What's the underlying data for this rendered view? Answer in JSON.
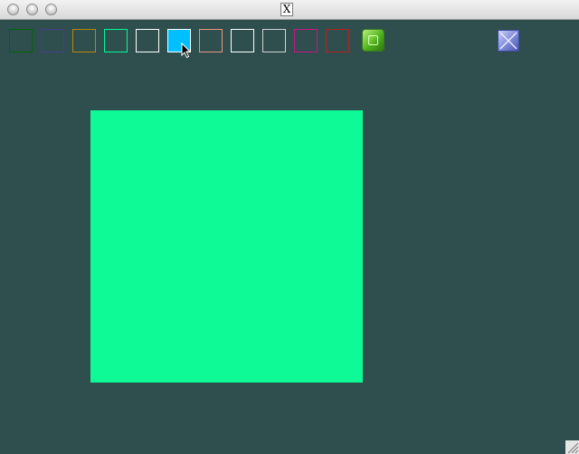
{
  "window": {
    "app_icon_letter": "X",
    "controls": [
      "close",
      "minimize",
      "zoom"
    ]
  },
  "toolbar": {
    "swatches": [
      {
        "name": "darkgreen",
        "color": "#006400",
        "selected": false
      },
      {
        "name": "darkslateblue",
        "color": "#483d8b",
        "selected": false
      },
      {
        "name": "darkgoldenrod",
        "color": "#b8860b",
        "selected": false
      },
      {
        "name": "mediumspringgreen",
        "color": "#00fa9a",
        "selected": false
      },
      {
        "name": "white",
        "color": "#ffffff",
        "selected": false
      },
      {
        "name": "deepskyblue",
        "color": "#00bfff",
        "selected": true
      },
      {
        "name": "darksalmon",
        "color": "#e9967a",
        "selected": false
      },
      {
        "name": "white-2",
        "color": "#ffffff",
        "selected": false
      },
      {
        "name": "lightgray",
        "color": "#d3d3d3",
        "selected": false
      },
      {
        "name": "mediumvioletred",
        "color": "#c71585",
        "selected": false
      },
      {
        "name": "firebrick",
        "color": "#b22222",
        "selected": false
      }
    ],
    "fill_button_icon": "green-square-icon",
    "clear_button_icon": "x-icon"
  },
  "canvas": {
    "background": "#2f4f4f",
    "shape": {
      "type": "square",
      "fill": "#0dfa96"
    }
  }
}
